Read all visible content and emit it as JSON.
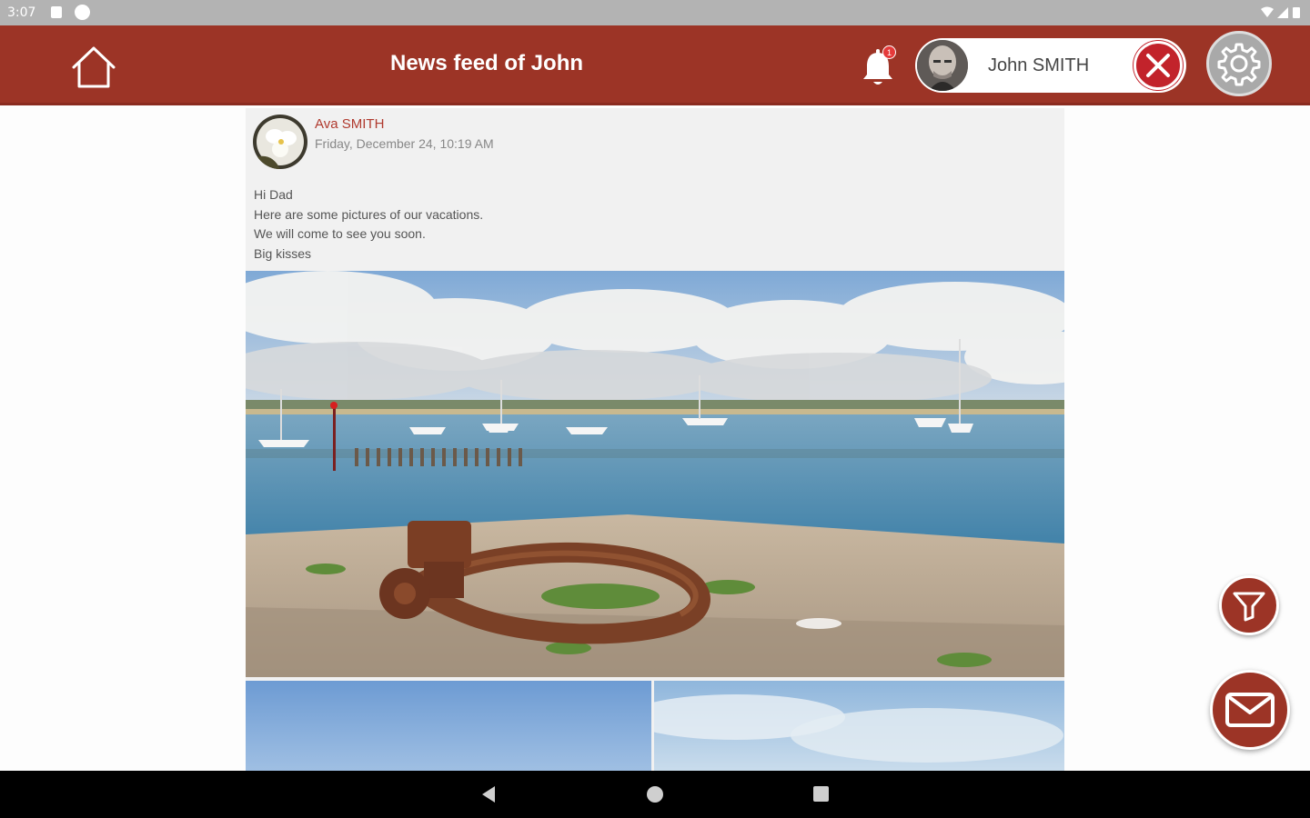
{
  "status_bar": {
    "time": "3:07"
  },
  "header": {
    "title": "News feed of John",
    "notification_count": "1",
    "user_name": "John SMITH"
  },
  "post": {
    "author": "Ava SMITH",
    "date": "Friday, December 24, 10:19 AM",
    "lines": [
      "Hi Dad",
      "Here are some pictures of our vacations.",
      "We will come to see you soon.",
      "Big kisses"
    ]
  },
  "colors": {
    "header": "#9c3426",
    "close_button": "#c2232b",
    "author_name": "#b03a2e"
  },
  "icons": {
    "home": "home-icon",
    "bell": "bell-icon",
    "close": "close-icon",
    "settings": "gear-icon",
    "filter": "filter-icon",
    "mail": "mail-icon"
  }
}
